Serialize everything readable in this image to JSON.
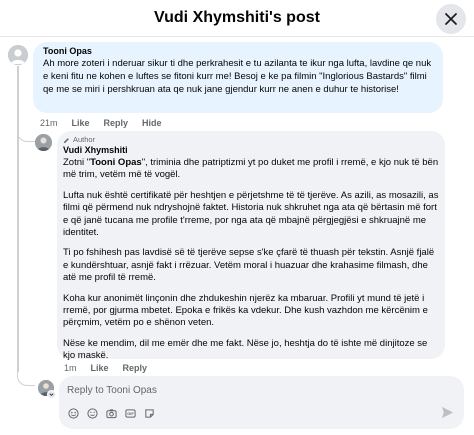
{
  "header": {
    "title": "Vudi Xhymshiti's post",
    "close_icon": "close-icon"
  },
  "comment": {
    "author": "Tooni Opas",
    "text": "Ah more zoteri i nderuar sikur ti dhe perkrahesit e tu azilanta te ikur nga lufta, lavdine qe nuk e keni fitu ne kohen e luftes se fitoni kurr me! Besoj e ke pa filmin \"Inglorious Bastards\" filmi qe me se miri i pershkruan ata qe nuk jane gjendur kurr ne anen e duhur te historise!",
    "time": "21m",
    "actions": {
      "like": "Like",
      "reply": "Reply",
      "hide": "Hide"
    }
  },
  "reply": {
    "badge": "Author",
    "author": "Vudi Xhymshiti",
    "salutation_before": "Zotni \"",
    "salutation_name": "Tooni Opas",
    "salutation_after": "\", triminia dhe patriptizmi yt po duket me profil i rremë, e kjo nuk të bën më trim, vetëm më të vogël.",
    "paragraphs": [
      "Lufta nuk është certifikatë për heshtjen e përjetshme të të tjerëve. As azili, as mosazili, as filmi që përmend nuk ndryshojnë faktet. Historia nuk shkruhet nga ata që bërtasin më fort e që janë tucana me profile t'rreme, por nga ata që mbajnë përgjegjësi e shkruajnë me identitet.",
      "Ti po fshihesh pas lavdisë së të tjerëve sepse s'ke çfarë të thuash për tekstin. Asnjë fjalë e kundërshtuar, asnjë fakt i rrëzuar. Vetëm moral i huazuar dhe krahasime filmash, dhe atë me profil të rremë.",
      "Koha kur anonimët linçonin dhe zhdukeshin njerëz ka mbaruar. Profili yt mund të jetë i rremë, por gjurma mbetet. Epoka e frikës ka vdekur. Dhe kush vazhdon me kërcënim e përçmim, vetëm po e shënon veten.",
      "Nëse ke mendim, dil me emër dhe me fakt. Nëse jo, heshtja do të ishte më dinjitoze se kjo maskë."
    ],
    "time": "1m",
    "actions": {
      "like": "Like",
      "reply": "Reply"
    }
  },
  "composer": {
    "placeholder": "Reply to Tooni Opas",
    "tools": [
      "sticker-icon",
      "emoji-icon",
      "camera-icon",
      "gif-icon",
      "chat-sticker-icon"
    ],
    "send_icon": "send-icon"
  },
  "colors": {
    "bubble_highlight": "#e7f3ff",
    "bubble": "#f0f2f5",
    "muted_text": "#65676b"
  }
}
